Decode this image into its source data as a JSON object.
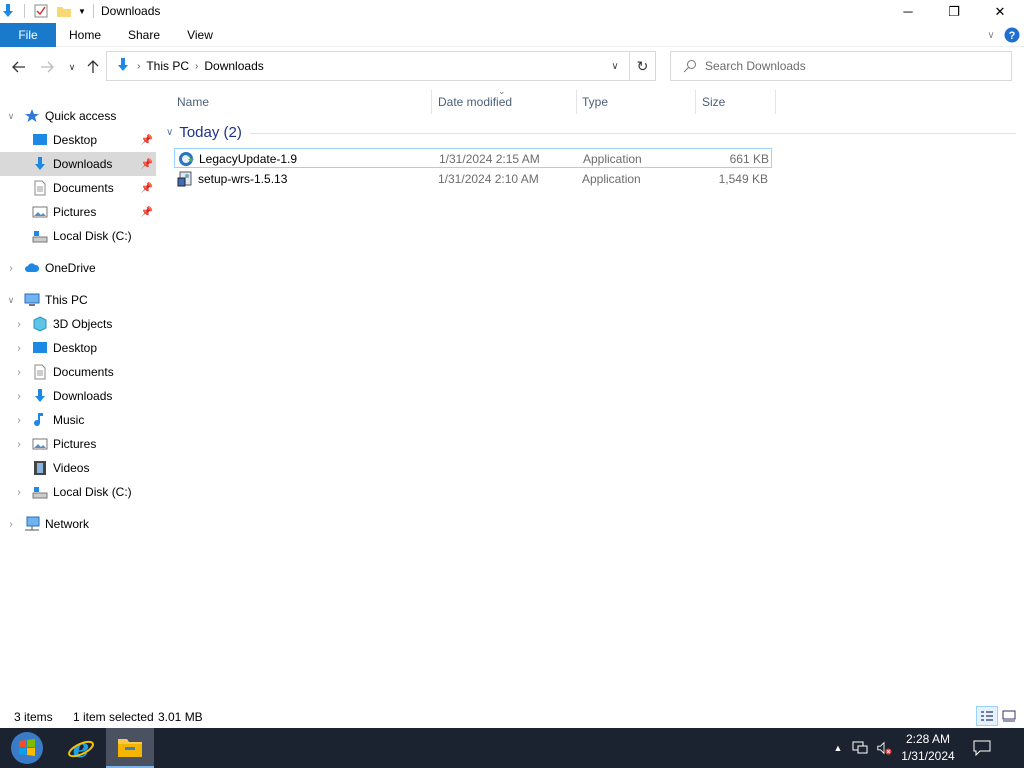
{
  "window": {
    "title": "Downloads",
    "controls": {
      "minimize": "─",
      "restore": "❐",
      "close": "✕"
    }
  },
  "ribbon": {
    "tabs": [
      {
        "label": "File"
      },
      {
        "label": "Home"
      },
      {
        "label": "Share"
      },
      {
        "label": "View"
      }
    ]
  },
  "address": {
    "crumbs": [
      "This PC",
      "Downloads"
    ],
    "search_placeholder": "Search Downloads"
  },
  "nav": {
    "quick_access": "Quick access",
    "qa_items": [
      "Desktop",
      "Downloads",
      "Documents",
      "Pictures",
      "Local Disk (C:)"
    ],
    "onedrive": "OneDrive",
    "this_pc": "This PC",
    "pc_items": [
      "3D Objects",
      "Desktop",
      "Documents",
      "Downloads",
      "Music",
      "Pictures",
      "Videos",
      "Local Disk (C:)"
    ],
    "network": "Network"
  },
  "content": {
    "columns": [
      "Name",
      "Date modified",
      "Type",
      "Size"
    ],
    "group": "Today (2)",
    "files": [
      {
        "name": "LegacyUpdate-1.9",
        "date": "1/31/2024 2:15 AM",
        "type": "Application",
        "size": "661 KB"
      },
      {
        "name": "setup-wrs-1.5.13",
        "date": "1/31/2024 2:10 AM",
        "type": "Application",
        "size": "1,549 KB"
      }
    ]
  },
  "status": {
    "count": "3 items",
    "selected": "1 item selected",
    "size": "3.01 MB"
  },
  "taskbar": {
    "time": "2:28 AM",
    "date": "1/31/2024"
  },
  "colors": {
    "accent": "#1979ca",
    "selection": "#cce8ff",
    "taskbar": "#1c2330",
    "group_header": "#1e3287"
  }
}
